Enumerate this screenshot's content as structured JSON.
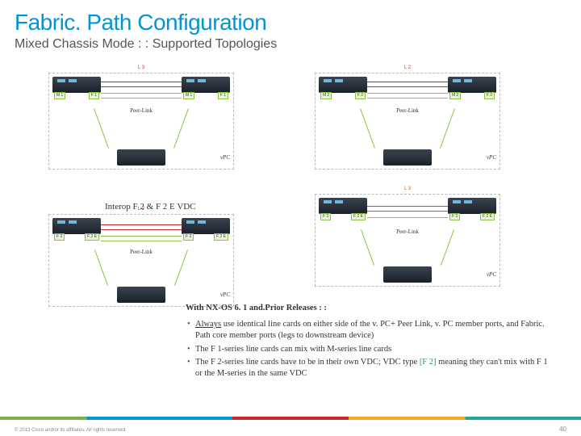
{
  "title": "Fabric. Path Configuration",
  "subtitle": "Mixed Chassis Mode : : Supported Topologies",
  "caption1": "Interop F 2 & F 2 E VDC",
  "topo": {
    "top_l3": "L 3",
    "top_l2": "L 2",
    "peerlink": "Peer-Link",
    "vpc": "vPC",
    "badge_m1": "M 1",
    "badge_m2": "M 2",
    "badge_f1": "F 1",
    "badge_f2": "F 2",
    "badge_f2e": "F 2 E"
  },
  "notes_title": "With NX-OS 6. 1 and.Prior Releases : :",
  "bullets": {
    "b1a": "Always",
    "b1b": " use identical line cards on either side of the v. PC+ Peer Link, v. PC member ports, and Fabric. Path core member ports (legs to downstream device)",
    "b2": "The F 1-series line cards can mix with M-series line cards",
    "b3a": "The F 2-series line cards have to be in their own VDC; VDC type ",
    "b3b": "[F 2]",
    "b3c": " meaning they can't mix with F 1 or the M-series in the same VDC"
  },
  "copyright": "© 2013 Cisco and/or its affiliates. All rights reserved.",
  "pagenum": "40"
}
